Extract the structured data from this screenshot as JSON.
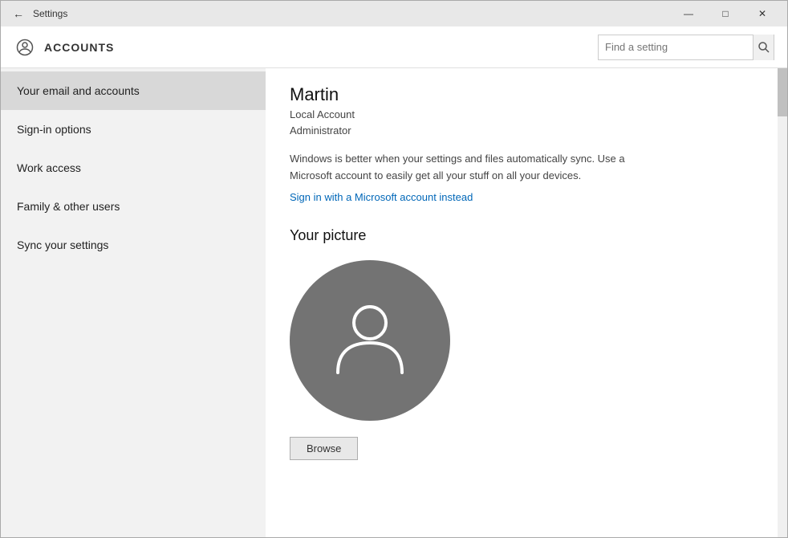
{
  "window": {
    "title": "Settings",
    "back_label": "←",
    "controls": {
      "minimize": "—",
      "maximize": "□",
      "close": "✕"
    }
  },
  "header": {
    "icon": "⚙",
    "title": "ACCOUNTS",
    "search_placeholder": "Find a setting",
    "search_icon": "🔍"
  },
  "sidebar": {
    "items": [
      {
        "label": "Your email and accounts",
        "active": true
      },
      {
        "label": "Sign-in options",
        "active": false
      },
      {
        "label": "Work access",
        "active": false
      },
      {
        "label": "Family & other users",
        "active": false
      },
      {
        "label": "Sync your settings",
        "active": false
      }
    ]
  },
  "content": {
    "user_name": "Martin",
    "account_type": "Local Account",
    "account_role": "Administrator",
    "sync_message": "Windows is better when your settings and files automatically sync. Use a Microsoft account to easily get all your stuff on all your devices.",
    "sign_in_link": "Sign in with a Microsoft account instead",
    "picture_section_title": "Your picture",
    "browse_button_label": "Browse"
  }
}
